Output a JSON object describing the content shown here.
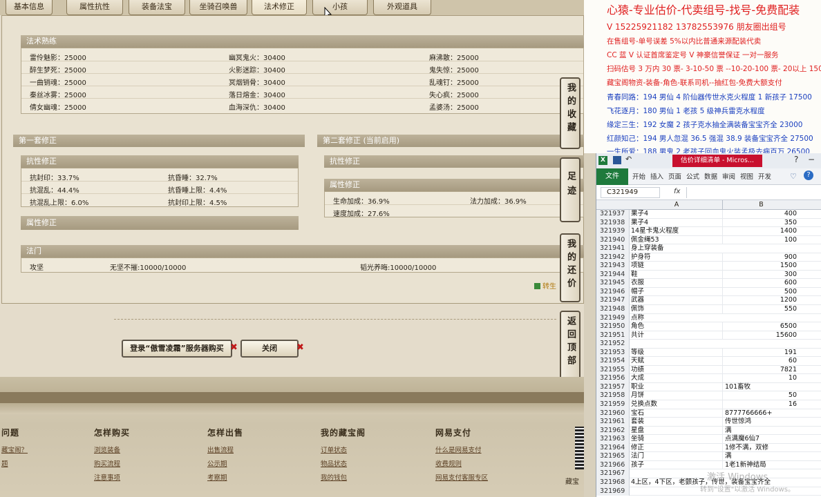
{
  "tabs": [
    "基本信息",
    "属性抗性",
    "装备法宝",
    "坐骑召唤兽",
    "法术修正",
    "小孩",
    "外观道具"
  ],
  "skill_section": {
    "title": "法术熟练",
    "col1": [
      "雷伶魅影：25000",
      "醉生梦死：25000",
      "一曲销魂：25000",
      "秦丝冰雾：25000",
      "倩女幽魂：25000"
    ],
    "col2": [
      "幽冥鬼火：30400",
      "火影迷踪：30400",
      "冥烟销骨：30400",
      "落日熔金：30400",
      "血海深仇：30400"
    ],
    "col3": [
      "麻沸散：25000",
      "鬼失惊：25000",
      "乱魂钉：25000",
      "失心疯：25000",
      "孟婆汤：25000"
    ]
  },
  "mod_set1": {
    "title": "第一套修正",
    "resist_title": "抗性修正",
    "resist_left": [
      "抗封印：33.7%",
      "抗混乱：44.4%",
      "抗混乱上限：6.0%"
    ],
    "resist_right": [
      "抗昏睡：32.7%",
      "抗昏睡上限：4.4%",
      "抗封印上限：4.5%"
    ],
    "attr_title": "属性修正"
  },
  "mod_set2": {
    "title": "第二套修正 (当前启用)",
    "resist_title": "抗性修正",
    "attr_title": "属性修正",
    "attr_left": [
      "生命加成：36.9%",
      "速度加成：27.6%"
    ],
    "attr_right": [
      "法力加成：36.9%"
    ]
  },
  "fa_men": {
    "title": "法门",
    "row": [
      "攻坚",
      "无坚不摧:10000/10000",
      "韬光养晦:10000/10000"
    ]
  },
  "side_buttons": [
    "我的收藏",
    "足迹",
    "我的还价",
    "返回顶部"
  ],
  "side_link": "转生",
  "bottom_buttons": {
    "login": "登录“傲雪凌霜”服务器购买",
    "close": "关闭"
  },
  "footer": {
    "cols": [
      {
        "title": "问题",
        "links": [
          "藏宝阁？",
          "题"
        ]
      },
      {
        "title": "怎样购买",
        "links": [
          "浏览装备",
          "购买流程",
          "注意事项"
        ]
      },
      {
        "title": "怎样出售",
        "links": [
          "出售流程",
          "公示期",
          "考察期"
        ]
      },
      {
        "title": "我的藏宝阁",
        "links": [
          "订单状态",
          "物品状态",
          "我的钱包"
        ]
      },
      {
        "title": "网易支付",
        "links": [
          "什么是网易支付",
          "收费规则",
          "网易支付客服专区"
        ]
      }
    ],
    "corner": "藏宝"
  },
  "ad": {
    "title": "心猿-专业估价-代卖组号-找号-免费配装",
    "lines": [
      "V 15225921182   13782553976 朋友圈出组号",
      "在售组号-单号误差 5%以内比普通来源配装代卖",
      "CC 蓝 V 认证首席鉴定号  V 神豪信誉保证  一对一服务",
      "扫码估号 3 万内 30 票- 3-10-50 票  --10-20-100 票- 20以上 150",
      "藏宝阁物资-装备-角色-联系司机--抽红包-免费大额支付",
      "青春同路：194 男仙 4 阶仙器传世水克火程度 1 新孩子 17500",
      "飞花逐月：180 男仙 1 老孩 5 级神兵雷克水程度",
      "缘定三生：192 女魔 2 孩子克水抽全满装备宝宝齐全 23000",
      "红颜知己：194 男人忽混 36.5 强混 38.9 装备宝宝齐全 27500",
      "一生所爱：188 男鬼 2 老孩子回血鬼火装孟极去病百万 26500"
    ]
  },
  "excel": {
    "title": "估价详细清单 - Micros...",
    "ribbon_tabs": [
      "文件",
      "开始",
      "插入",
      "页面",
      "公式",
      "数据",
      "审阅",
      "视图",
      "开发"
    ],
    "name_box": "C321949",
    "fx": "fx",
    "col_a": "A",
    "col_b": "B",
    "rows": [
      [
        "321937",
        "果子4",
        "400"
      ],
      [
        "321938",
        "果子4",
        "350"
      ],
      [
        "321939",
        "14星卡鬼火程度",
        "1400"
      ],
      [
        "321940",
        "佩金绳53",
        "100"
      ],
      [
        "321941",
        "身上穿装备",
        ""
      ],
      [
        "321942",
        "护身符",
        "900"
      ],
      [
        "321943",
        "项链",
        "1500"
      ],
      [
        "321944",
        "鞋",
        "300"
      ],
      [
        "321945",
        "衣服",
        "600"
      ],
      [
        "321946",
        "帽子",
        "500"
      ],
      [
        "321947",
        "武器",
        "1200"
      ],
      [
        "321948",
        "佩饰",
        "550"
      ],
      [
        "321949",
        "点称",
        ""
      ],
      [
        "321950",
        "角色",
        "6500"
      ],
      [
        "321951",
        "共计",
        "15600"
      ],
      [
        "321952",
        "",
        ""
      ],
      [
        "321953",
        "等级",
        "191"
      ],
      [
        "321954",
        "天赋",
        "60"
      ],
      [
        "321955",
        "功绩",
        "7821"
      ],
      [
        "321956",
        "大成",
        "10"
      ],
      [
        "321957",
        "职业",
        "101畜牧"
      ],
      [
        "321958",
        "月饼",
        "50"
      ],
      [
        "321959",
        "兑换点数",
        "16"
      ],
      [
        "321960",
        "宝石",
        "8777766666+"
      ],
      [
        "321961",
        "套装",
        "传世惊鸿"
      ],
      [
        "321962",
        "星盘",
        "满"
      ],
      [
        "321963",
        "坐骑",
        "点满魔6仙7"
      ],
      [
        "321964",
        "修正",
        "1修不满，双修"
      ],
      [
        "321965",
        "法门",
        "满"
      ],
      [
        "321966",
        "孩子",
        "1老1新神结局"
      ],
      [
        "321967",
        "",
        ""
      ],
      [
        "321968",
        "4上区，4下区，老颤孩子，传世，装备宝宝齐全",
        ""
      ],
      [
        "321969",
        "",
        ""
      ]
    ],
    "watermark1": "激活 Windows",
    "watermark2": "转到\"设置\"以激活 Windows。"
  },
  "colors": {
    "ad_red": "#e02020",
    "ad_blue": "#1a3fbf",
    "excel_green": "#1f7a3c"
  }
}
